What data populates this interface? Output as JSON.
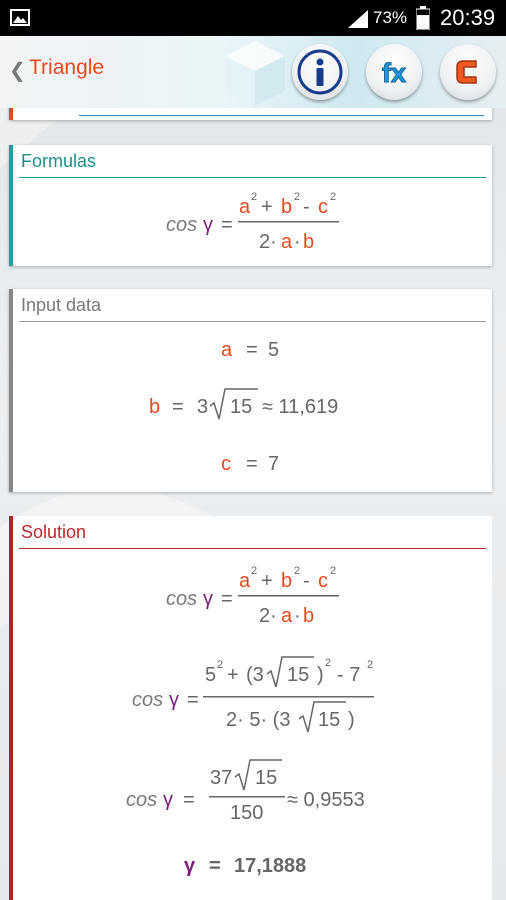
{
  "status_bar": {
    "battery_percent": "73%",
    "time": "20:39"
  },
  "action_bar": {
    "back_glyph": "❮",
    "title": "Triangle",
    "buttons": [
      {
        "name": "info-button",
        "label": "i"
      },
      {
        "name": "formulas-button",
        "label": "fx"
      },
      {
        "name": "calculator-button",
        "label": "C"
      }
    ]
  },
  "colors": {
    "accent_orange": "#e8491d",
    "teal": "#1aa29f",
    "grey": "#888888",
    "red": "#c0262b",
    "purple": "#7b1f7e",
    "info_blue": "#1a3b8c",
    "fx_blue": "#1e9be0"
  },
  "formulas": {
    "title": "Formulas",
    "lhs_cos": "cos",
    "lhs_gamma": "γ",
    "eq": "=",
    "num_a": "a",
    "num_a_exp": "2",
    "plus": "+",
    "num_b": "b",
    "num_b_exp": "2",
    "minus": "-",
    "num_c": "c",
    "num_c_exp": "2",
    "den_2": "2·",
    "den_a": "a",
    "den_dot": "·",
    "den_b": "b"
  },
  "input_data": {
    "title": "Input data",
    "a_name": "a",
    "a_eq": "=",
    "a_value": "5",
    "b_name": "b",
    "b_eq": "=",
    "b_coef": "3",
    "b_radicand": "15",
    "b_approx": "≈ 11,619",
    "c_name": "c",
    "c_eq": "=",
    "c_value": "7"
  },
  "solution": {
    "title": "Solution",
    "step1": {
      "lhs_cos": "cos",
      "lhs_gamma": "γ",
      "eq": "=",
      "num_a": "a",
      "num_a_exp": "2",
      "plus": "+",
      "num_b": "b",
      "num_b_exp": "2",
      "minus": "-",
      "num_c": "c",
      "num_c_exp": "2",
      "den_2": "2·",
      "den_a": "a",
      "den_dot": "·",
      "den_b": "b"
    },
    "step2": {
      "lhs_cos": "cos",
      "lhs_gamma": "γ",
      "eq": "=",
      "n1": "5",
      "n1_exp": "2",
      "plus": "+",
      "open": "(3",
      "radicand": "15",
      "close": ")",
      "n2_exp": "2",
      "minus": "- 7",
      "n3_exp": "2",
      "den_prefix": "2· 5· (3",
      "den_radicand": "15",
      "den_close": ")"
    },
    "step3": {
      "lhs_cos": "cos",
      "lhs_gamma": "γ",
      "eq": "=",
      "num_coef": "37",
      "num_radicand": "15",
      "den": "150",
      "approx": "≈ 0,9553"
    },
    "result": {
      "gamma": "γ",
      "eq": "=",
      "value": "17,1888"
    }
  }
}
